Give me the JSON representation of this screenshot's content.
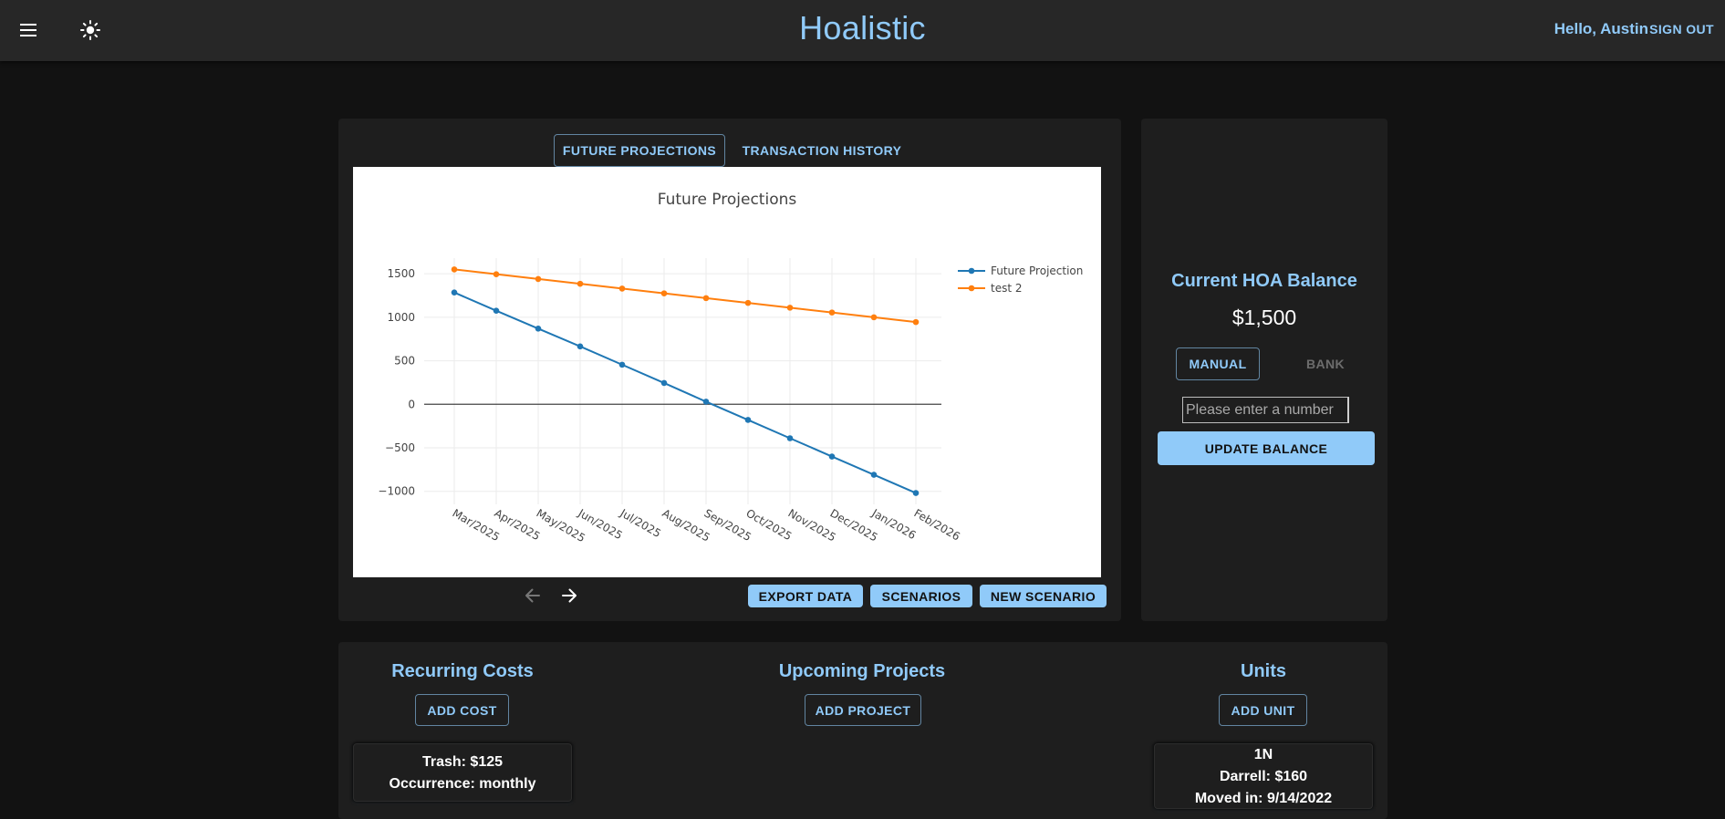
{
  "header": {
    "app_title": "Hoalistic",
    "greeting": "Hello, Austin",
    "signout_label": "SIGN OUT",
    "menu_icon": "menu-icon",
    "theme_icon": "sun-icon"
  },
  "tabs": [
    {
      "label": "FUTURE PROJECTIONS",
      "active": true
    },
    {
      "label": "TRANSACTION HISTORY",
      "active": false
    }
  ],
  "chart_data": {
    "type": "line",
    "title": "Future Projections",
    "xlabel": "",
    "ylabel": "",
    "categories": [
      "Mar/2025",
      "Apr/2025",
      "May/2025",
      "Jun/2025",
      "Jul/2025",
      "Aug/2025",
      "Sep/2025",
      "Oct/2025",
      "Nov/2025",
      "Dec/2025",
      "Jan/2026",
      "Feb/2026"
    ],
    "ylim": [
      -1150,
      1680
    ],
    "yticks": [
      1500,
      1000,
      500,
      0,
      -500,
      -1000
    ],
    "ytick_labels": [
      "1500",
      "1000",
      "500",
      "0",
      "−500",
      "−1000"
    ],
    "grid": true,
    "legend_position": "top-right",
    "series": [
      {
        "name": "Future Projection",
        "color": "#1f77b4",
        "values": [
          1285,
          1075,
          870,
          665,
          455,
          245,
          30,
          -180,
          -390,
          -600,
          -810,
          -1020
        ]
      },
      {
        "name": "test 2",
        "color": "#ff7f0e",
        "values": [
          1550,
          1495,
          1440,
          1385,
          1330,
          1275,
          1220,
          1165,
          1110,
          1055,
          1000,
          945
        ]
      }
    ]
  },
  "chart_nav": {
    "prev_icon": "arrow-left-icon",
    "next_icon": "arrow-right-icon"
  },
  "actions": {
    "export_label": "EXPORT DATA",
    "scenarios_label": "SCENARIOS",
    "new_scenario_label": "NEW SCENARIO"
  },
  "balance": {
    "title": "Current HOA Balance",
    "value": "$1,500",
    "manual_label": "MANUAL",
    "bank_label": "BANK",
    "input_placeholder": "Please enter a number",
    "input_value": "",
    "update_label": "UPDATE BALANCE"
  },
  "recurring": {
    "title": "Recurring Costs",
    "add_label": "ADD COST",
    "items": [
      {
        "line1": "Trash: $125",
        "line2": "Occurrence: monthly"
      }
    ]
  },
  "projects": {
    "title": "Upcoming Projects",
    "add_label": "ADD PROJECT"
  },
  "units": {
    "title": "Units",
    "add_label": "ADD UNIT",
    "items": [
      {
        "name": "1N",
        "owner": "Darrell: $160",
        "moved": "Moved in: 9/14/2022"
      }
    ]
  }
}
